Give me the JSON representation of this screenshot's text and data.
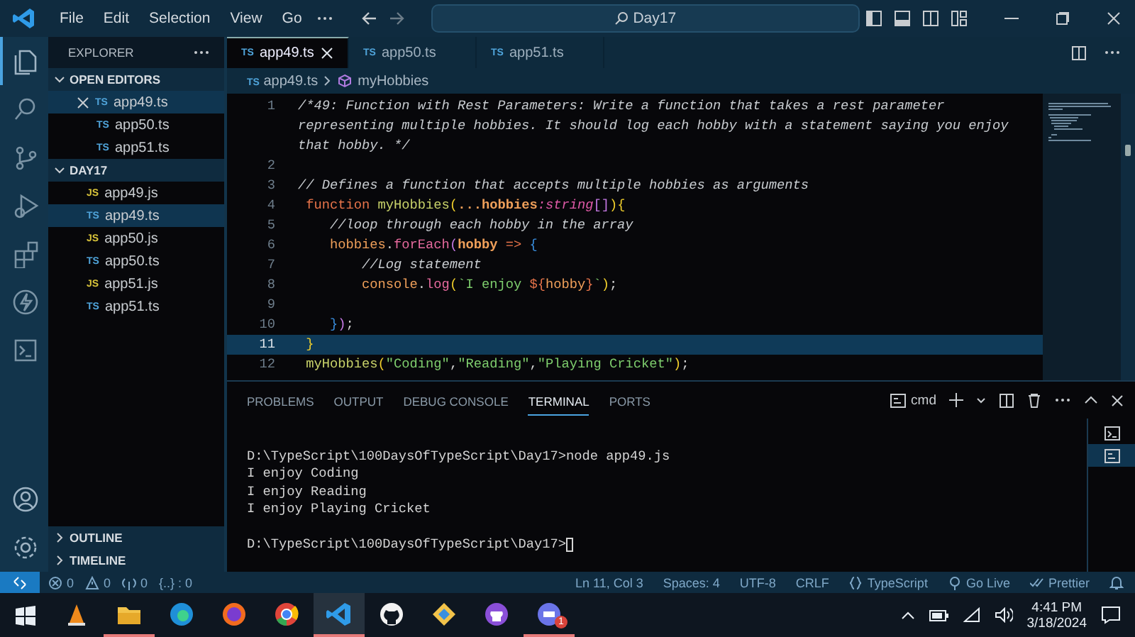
{
  "title_bar": {
    "menus": [
      "File",
      "Edit",
      "Selection",
      "View",
      "Go"
    ],
    "search": "Day17"
  },
  "activity_bar": [
    {
      "kind": "files",
      "selected": true
    },
    {
      "kind": "search",
      "selected": false
    },
    {
      "kind": "branch",
      "selected": false
    },
    {
      "kind": "run",
      "selected": false
    },
    {
      "kind": "extensions",
      "selected": false
    },
    {
      "kind": "lightning",
      "selected": false
    },
    {
      "kind": "terminal",
      "selected": false
    }
  ],
  "activity_bottom": [
    {
      "kind": "account"
    },
    {
      "kind": "settings"
    }
  ],
  "sidebar": {
    "title": "EXPLORER",
    "sections": [
      {
        "label": "OPEN EDITORS",
        "expanded": true,
        "items": [
          {
            "kind": "ts",
            "badge": "TS",
            "name": "app49.ts",
            "selected": true
          },
          {
            "kind": "ts",
            "badge": "TS",
            "name": "app50.ts",
            "selected": false
          },
          {
            "kind": "ts",
            "badge": "TS",
            "name": "app51.ts",
            "selected": false
          }
        ]
      },
      {
        "label": "DAY17",
        "expanded": true,
        "items": [
          {
            "kind": "js",
            "badge": "JS",
            "name": "app49.js",
            "selected": false
          },
          {
            "kind": "ts",
            "badge": "TS",
            "name": "app49.ts",
            "selected": true
          },
          {
            "kind": "js",
            "badge": "JS",
            "name": "app50.js",
            "selected": false
          },
          {
            "kind": "ts",
            "badge": "TS",
            "name": "app50.ts",
            "selected": false
          },
          {
            "kind": "js",
            "badge": "JS",
            "name": "app51.js",
            "selected": false
          },
          {
            "kind": "ts",
            "badge": "TS",
            "name": "app51.ts",
            "selected": false
          }
        ]
      }
    ],
    "footer_sections": [
      {
        "label": "OUTLINE",
        "expanded": false
      },
      {
        "label": "TIMELINE",
        "expanded": false
      }
    ]
  },
  "editor": {
    "tabs": [
      {
        "badge": "TS",
        "label": "app49.ts",
        "selected": true
      },
      {
        "badge": "TS",
        "label": "app50.ts",
        "selected": false
      },
      {
        "badge": "TS",
        "label": "app51.ts",
        "selected": false
      }
    ],
    "breadcrumb": {
      "file_badge": "TS",
      "file": "app49.ts",
      "symbol": "myHobbies"
    },
    "lines": [
      {
        "number": "1",
        "current": false,
        "tokens": [
          {
            "kind": "comment",
            "text": "/*49: Function with Rest Parameters: Write a function that takes a rest parameter representing multiple hobbies. It should log each hobby with a statement saying you enjoy that hobby. */"
          }
        ]
      },
      {
        "number": "2",
        "current": false
      },
      {
        "number": "3",
        "current": false,
        "tokens": [
          {
            "kind": "comment",
            "text": "// Defines a function that accepts multiple hobbies as arguments"
          }
        ]
      },
      {
        "number": "4",
        "current": false,
        "tokens": [
          {
            "kind": "keyword",
            "text": " function "
          },
          {
            "kind": "func",
            "text": "myHobbies"
          },
          {
            "kind": "bracket",
            "text": "("
          },
          {
            "kind": "param",
            "text": "...hobbies"
          },
          {
            "kind": "type",
            "text": ":string"
          },
          {
            "kind": "bracket2",
            "text": "[]"
          },
          {
            "kind": "bracket",
            "text": "){"
          }
        ]
      },
      {
        "number": "5",
        "current": false,
        "tokens": [
          {
            "kind": "comment",
            "text": "    //loop through each hobby in the array"
          }
        ]
      },
      {
        "number": "6",
        "current": false,
        "tokens": [
          {
            "kind": "variable",
            "text": "    hobbies"
          },
          {
            "kind": "punct",
            "text": "."
          },
          {
            "kind": "method",
            "text": "forEach"
          },
          {
            "kind": "bracket2",
            "text": "("
          },
          {
            "kind": "param",
            "text": "hobby"
          },
          {
            "kind": "keyword",
            "text": " => "
          },
          {
            "kind": "bracket3",
            "text": "{"
          }
        ]
      },
      {
        "number": "7",
        "current": false,
        "tokens": [
          {
            "kind": "comment",
            "text": "        //Log statement"
          }
        ]
      },
      {
        "number": "8",
        "current": false,
        "tokens": [
          {
            "kind": "variable",
            "text": "        console"
          },
          {
            "kind": "punct",
            "text": "."
          },
          {
            "kind": "method",
            "text": "log"
          },
          {
            "kind": "bracket",
            "text": "("
          },
          {
            "kind": "string",
            "text": "`I enjoy "
          },
          {
            "kind": "keyword",
            "text": "${"
          },
          {
            "kind": "variable",
            "text": "hobby"
          },
          {
            "kind": "keyword",
            "text": "}"
          },
          {
            "kind": "string",
            "text": "`"
          },
          {
            "kind": "bracket",
            "text": ")"
          },
          {
            "kind": "punct",
            "text": ";"
          }
        ]
      },
      {
        "number": "9",
        "current": false
      },
      {
        "number": "10",
        "current": false,
        "tokens": [
          {
            "kind": "bracket3",
            "text": "    }"
          },
          {
            "kind": "bracket2",
            "text": ")"
          },
          {
            "kind": "punct",
            "text": ";"
          }
        ]
      },
      {
        "number": "11",
        "current": true,
        "tokens": [
          {
            "kind": "bracket",
            "text": " }"
          }
        ]
      },
      {
        "number": "12",
        "current": false,
        "tokens": [
          {
            "kind": "func",
            "text": " myHobbies"
          },
          {
            "kind": "bracket",
            "text": "("
          },
          {
            "kind": "string",
            "text": "\"Coding\""
          },
          {
            "kind": "punct",
            "text": ","
          },
          {
            "kind": "string",
            "text": "\"Reading\""
          },
          {
            "kind": "punct",
            "text": ","
          },
          {
            "kind": "string",
            "text": "\"Playing Cricket\""
          },
          {
            "kind": "bracket",
            "text": ")"
          },
          {
            "kind": "punct",
            "text": ";"
          }
        ]
      }
    ]
  },
  "panel": {
    "tabs": [
      {
        "label": "PROBLEMS",
        "selected": false
      },
      {
        "label": "OUTPUT",
        "selected": false
      },
      {
        "label": "DEBUG CONSOLE",
        "selected": false
      },
      {
        "label": "TERMINAL",
        "selected": true
      },
      {
        "label": "PORTS",
        "selected": false
      }
    ],
    "shell": "cmd",
    "terminal_blocks": [
      {
        "lines": [
          "D:\\TypeScript\\100DaysOfTypeScript\\Day17>node app49.js",
          "I enjoy Coding",
          "I enjoy Reading",
          "I enjoy Playing Cricket"
        ],
        "cursor": false
      },
      {
        "lines": [
          "D:\\TypeScript\\100DaysOfTypeScript\\Day17>"
        ],
        "cursor": true
      }
    ],
    "terminals": [
      {
        "kind": "shell",
        "selected": false
      },
      {
        "kind": "cmd",
        "selected": true
      }
    ]
  },
  "status_bar": {
    "left": [
      {
        "kind": "error",
        "text": "0"
      },
      {
        "kind": "warning",
        "text": "0"
      },
      {
        "kind": "ports",
        "text": "0"
      },
      {
        "kind": "plain",
        "text": "{..} : 0"
      }
    ],
    "right": [
      {
        "kind": "plain",
        "text": "Ln 11, Col 3"
      },
      {
        "kind": "plain",
        "text": "Spaces: 4"
      },
      {
        "kind": "plain",
        "text": "UTF-8"
      },
      {
        "kind": "plain",
        "text": "CRLF"
      },
      {
        "kind": "braces",
        "text": "TypeScript"
      },
      {
        "kind": "broadcast",
        "text": "Go Live"
      },
      {
        "kind": "double-check",
        "text": "Prettier"
      },
      {
        "kind": "bell"
      }
    ]
  },
  "taskbar": {
    "apps": [
      {
        "kind": "cone",
        "running": false,
        "selected": false
      },
      {
        "kind": "folder",
        "running": true,
        "selected": false
      },
      {
        "kind": "edge",
        "running": false,
        "selected": false
      },
      {
        "kind": "firefox",
        "running": false,
        "selected": false
      },
      {
        "kind": "chrome",
        "running": false,
        "selected": false
      },
      {
        "kind": "vscode",
        "running": true,
        "selected": true
      },
      {
        "kind": "github",
        "running": false,
        "selected": false
      },
      {
        "kind": "git",
        "running": false,
        "selected": false
      },
      {
        "kind": "github-desktop",
        "running": false,
        "selected": false
      },
      {
        "kind": "discord",
        "running": true,
        "selected": false,
        "badge": "1"
      }
    ],
    "time": "4:41 PM",
    "date": "3/18/2024"
  }
}
